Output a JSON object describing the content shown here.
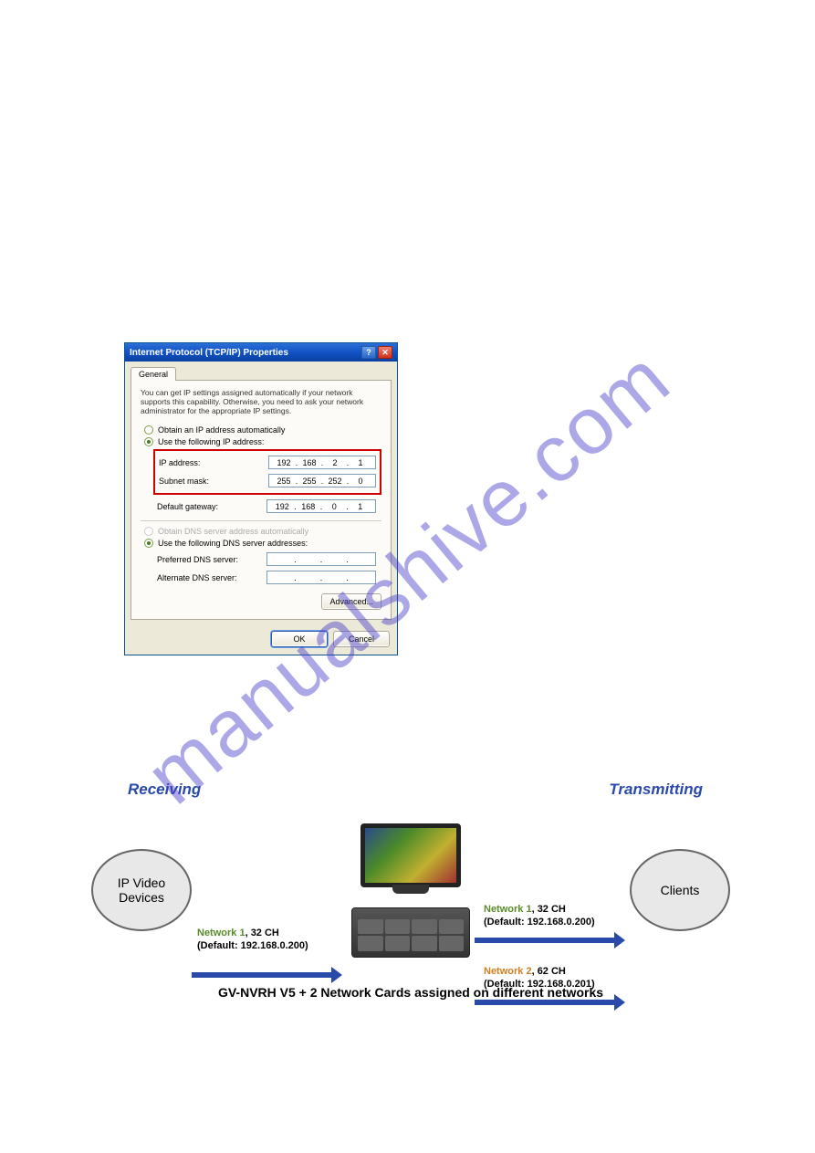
{
  "watermark": "manualshive.com",
  "dialog": {
    "title": "Internet Protocol (TCP/IP) Properties",
    "tab": "General",
    "help": "You can get IP settings assigned automatically if your network supports this capability. Otherwise, you need to ask your network administrator for the appropriate IP settings.",
    "radio_auto_ip": "Obtain an IP address automatically",
    "radio_use_ip": "Use the following IP address:",
    "fields": {
      "ip_label": "IP address:",
      "ip_value": [
        "192",
        "168",
        "2",
        "1"
      ],
      "mask_label": "Subnet mask:",
      "mask_value": [
        "255",
        "255",
        "252",
        "0"
      ],
      "gw_label": "Default gateway:",
      "gw_value": [
        "192",
        "168",
        "0",
        "1"
      ]
    },
    "radio_auto_dns": "Obtain DNS server address automatically",
    "radio_use_dns": "Use the following DNS server addresses:",
    "dns": {
      "pref_label": "Preferred DNS server:",
      "alt_label": "Alternate DNS server:"
    },
    "advanced": "Advanced...",
    "ok": "OK",
    "cancel": "Cancel"
  },
  "diagram": {
    "receiving": "Receiving",
    "transmitting": "Transmitting",
    "left_oval": "IP Video\nDevices",
    "right_oval": "Clients",
    "rx_net1_a": "Network 1",
    "rx_net1_b": ", 32 CH",
    "rx_net1_c": "(Default: 192.168.0.200)",
    "tx_net1_a": "Network 1",
    "tx_net1_b": ", 32 CH",
    "tx_net1_c": "(Default: 192.168.0.200)",
    "tx_net2_a": "Network 2",
    "tx_net2_b": ", 62 CH",
    "tx_net2_c": "(Default: 192.168.0.201)",
    "caption": "GV-NVRH V5 + 2 Network Cards assigned on different networks"
  }
}
